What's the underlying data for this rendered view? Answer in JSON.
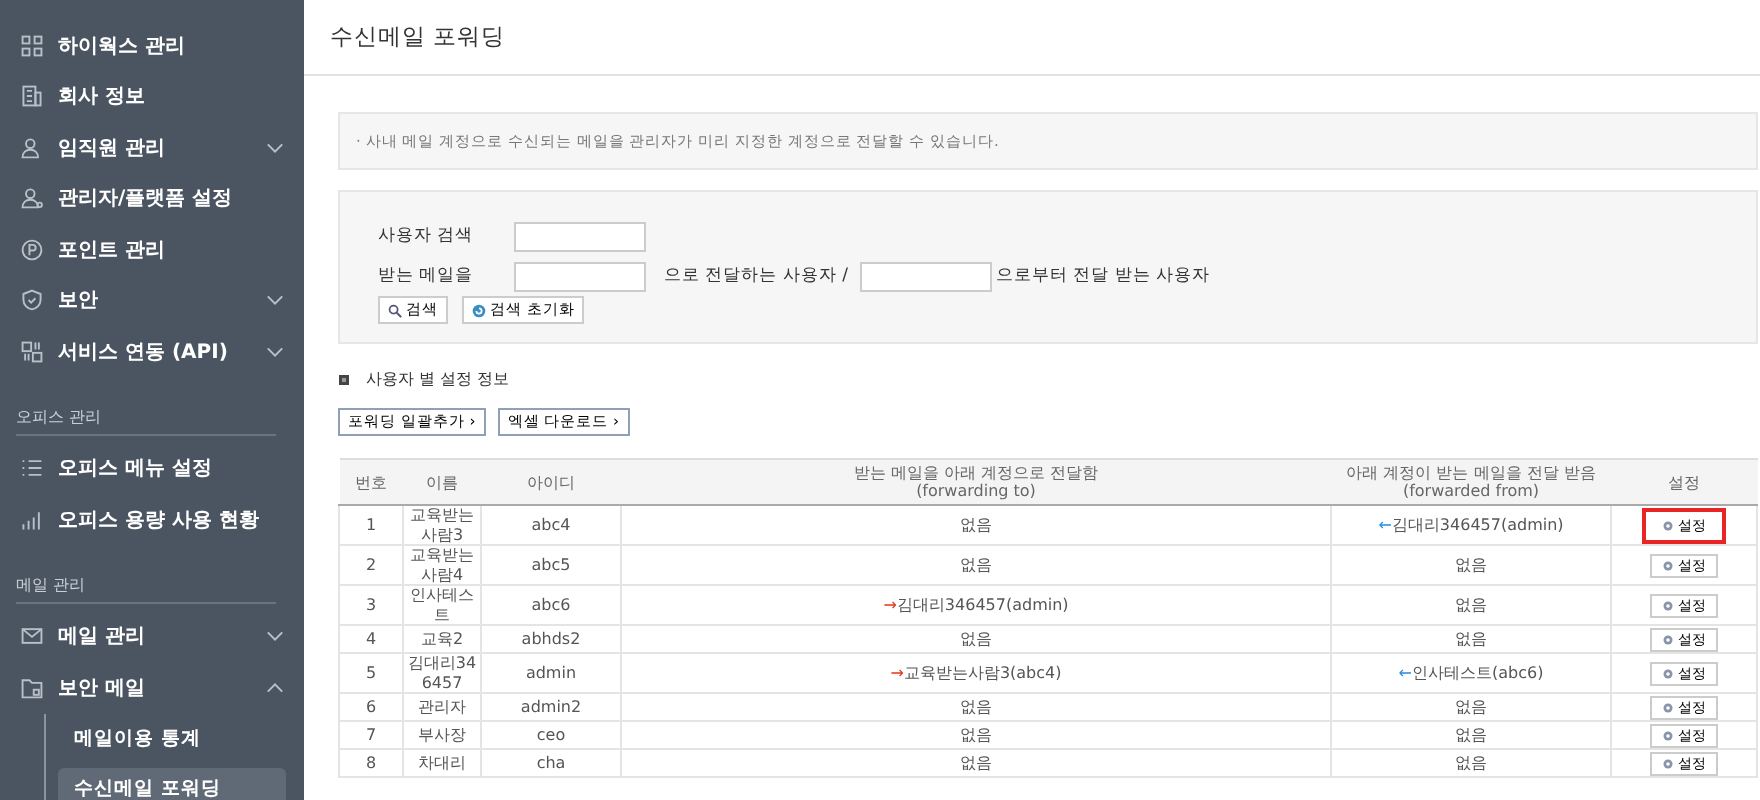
{
  "sidebar": {
    "items": [
      {
        "kind": "item",
        "label": "하이웍스 관리"
      },
      {
        "kind": "item",
        "label": "회사 정보"
      },
      {
        "kind": "item",
        "label": "임직원 관리",
        "expandable": true,
        "expanded": false
      },
      {
        "kind": "item",
        "label": "관리자/플랫폼 설정"
      },
      {
        "kind": "item",
        "label": "포인트 관리"
      },
      {
        "kind": "item",
        "label": "보안",
        "expandable": true,
        "expanded": false
      },
      {
        "kind": "item",
        "label": "서비스 연동 (API)",
        "expandable": true,
        "expanded": false
      },
      {
        "kind": "section",
        "label": "오피스 관리"
      },
      {
        "kind": "item",
        "label": "오피스 메뉴 설정"
      },
      {
        "kind": "item",
        "label": "오피스 용량 사용 현황"
      },
      {
        "kind": "section",
        "label": "메일 관리"
      },
      {
        "kind": "item",
        "label": "메일 관리",
        "expandable": true,
        "expanded": false
      },
      {
        "kind": "item",
        "label": "보안 메일",
        "expandable": true,
        "expanded": true,
        "children": [
          {
            "label": "메일이용 통계",
            "selected": false
          },
          {
            "label": "수신메일 포워딩",
            "selected": true
          }
        ]
      }
    ]
  },
  "page": {
    "title": "수신메일 포워딩",
    "notice": "· 사내 메일 계정으로 수신되는 메일을 관리자가 미리 지정한 계정으로 전달할 수 있습니다."
  },
  "search": {
    "user_label": "사용자 검색",
    "mail_label": "받는 메일을",
    "forward_to_label": "으로 전달하는 사용자 /",
    "forward_from_label": "으로부터 전달 받는 사용자",
    "search_button": "검색",
    "reset_button": "검색 초기화"
  },
  "section_title": "사용자 별 설정 정보",
  "actions": [
    "포워딩 일괄추가 ›",
    "엑셀 다운로드 ›"
  ],
  "table": {
    "columns": [
      {
        "label": "번호"
      },
      {
        "label": "이름"
      },
      {
        "label": "아이디"
      },
      {
        "label": "받는 메일을 아래 계정으로 전달함",
        "sub": "(forwarding to)"
      },
      {
        "label": "아래 계정이 받는 메일을 전달 받음",
        "sub": "(forwarded from)"
      },
      {
        "label": "설정"
      }
    ],
    "rows": [
      {
        "no": "1",
        "name": "교육받는사람3",
        "id": "abc4",
        "to": {
          "kind": "none",
          "text": "없음"
        },
        "from": {
          "kind": "forward",
          "arrow": "←",
          "text": "김대리346457(admin)"
        },
        "button": "설정",
        "highlighted": true
      },
      {
        "no": "2",
        "name": "교육받는사람4",
        "id": "abc5",
        "to": {
          "kind": "none",
          "text": "없음"
        },
        "from": {
          "kind": "none",
          "text": "없음"
        },
        "button": "설정",
        "highlighted": false
      },
      {
        "no": "3",
        "name": "인사테스트",
        "id": "abc6",
        "to": {
          "kind": "forward",
          "arrow": "→",
          "text": "김대리346457(admin)"
        },
        "from": {
          "kind": "none",
          "text": "없음"
        },
        "button": "설정",
        "highlighted": false
      },
      {
        "no": "4",
        "name": "교육2",
        "id": "abhds2",
        "to": {
          "kind": "none",
          "text": "없음"
        },
        "from": {
          "kind": "none",
          "text": "없음"
        },
        "button": "설정",
        "highlighted": false
      },
      {
        "no": "5",
        "name": "김대리346457",
        "id": "admin",
        "to": {
          "kind": "forward",
          "arrow": "→",
          "text": "교육받는사람3(abc4)"
        },
        "from": {
          "kind": "forward",
          "arrow": "←",
          "text": "인사테스트(abc6)"
        },
        "button": "설정",
        "highlighted": false
      },
      {
        "no": "6",
        "name": "관리자",
        "id": "admin2",
        "to": {
          "kind": "none",
          "text": "없음"
        },
        "from": {
          "kind": "none",
          "text": "없음"
        },
        "button": "설정",
        "highlighted": false
      },
      {
        "no": "7",
        "name": "부사장",
        "id": "ceo",
        "to": {
          "kind": "none",
          "text": "없음"
        },
        "from": {
          "kind": "none",
          "text": "없음"
        },
        "button": "설정",
        "highlighted": false
      },
      {
        "no": "8",
        "name": "차대리",
        "id": "cha",
        "to": {
          "kind": "none",
          "text": "없음"
        },
        "from": {
          "kind": "none",
          "text": "없음"
        },
        "button": "설정",
        "highlighted": false
      }
    ]
  }
}
